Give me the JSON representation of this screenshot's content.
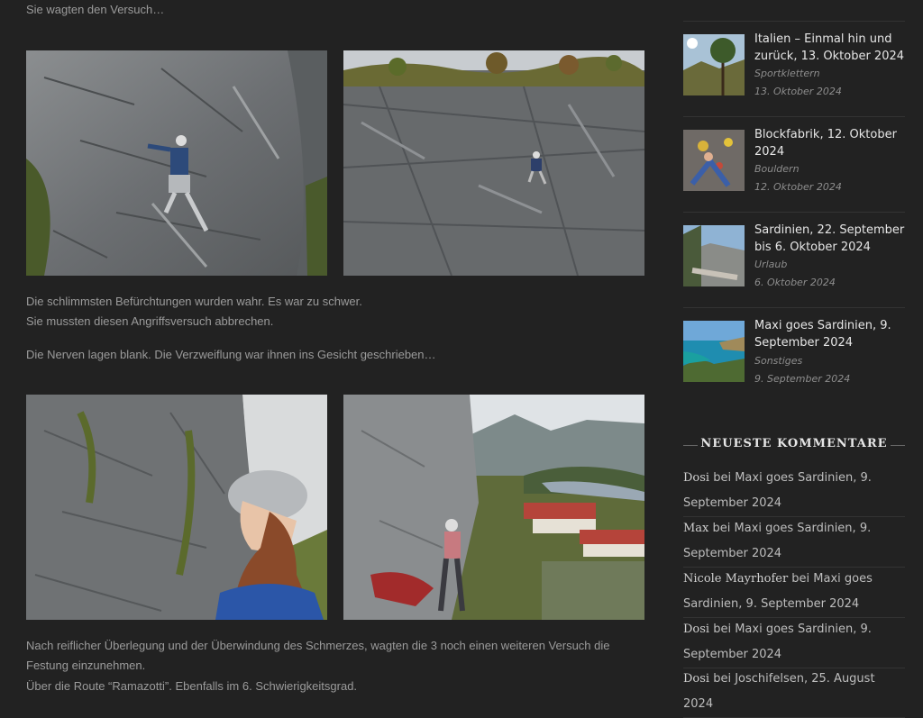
{
  "article": {
    "intro": "Sie wagten den Versuch…",
    "para1_line1": "Die schlimmsten Befürchtungen wurden wahr. Es war zu schwer.",
    "para1_line2": "Sie mussten diesen Angriffsversuch abbrechen.",
    "para2": "Die Nerven lagen blank. Die Verzweiflung war ihnen ins Gesicht geschrieben…",
    "para3_line1": "Nach reiflicher Überlegung und der Überwindung des Schmerzes, wagten die 3 noch einen weiteren Versuch die",
    "para3_line2": "Festung einzunehmen.",
    "para4": "Über die Route “Ramazotti”. Ebenfalls im 6. Schwierigkeitsgrad."
  },
  "sidebar": {
    "recent_posts": [
      {
        "title": "Italien – Einmal hin und zurück, 13. Oktober 2024",
        "category": "Sportklettern",
        "date": "13. Oktober 2024"
      },
      {
        "title": "Blockfabrik, 12. Oktober 2024",
        "category": "Bouldern",
        "date": "12. Oktober 2024"
      },
      {
        "title": "Sardinien, 22. September bis 6. Oktober 2024",
        "category": "Urlaub",
        "date": "6. Oktober 2024"
      },
      {
        "title": "Maxi goes Sardinien, 9. September 2024",
        "category": "Sonstiges",
        "date": "9. September 2024"
      }
    ],
    "comments_title": "NEUESTE KOMMENTARE",
    "comments": [
      {
        "author": "Dosi",
        "text": " bei Maxi goes Sardinien, 9. September 2024"
      },
      {
        "author": "Max",
        "text": " bei Maxi goes Sardinien, 9. September 2024"
      },
      {
        "author": "Nicole Mayrhofer",
        "text": " bei Maxi goes Sardinien, 9. September 2024"
      },
      {
        "author": "Dosi",
        "text": " bei Maxi goes Sardinien, 9. September 2024"
      },
      {
        "author": "Dosi",
        "text": " bei Joschifelsen, 25. August 2024"
      }
    ]
  }
}
